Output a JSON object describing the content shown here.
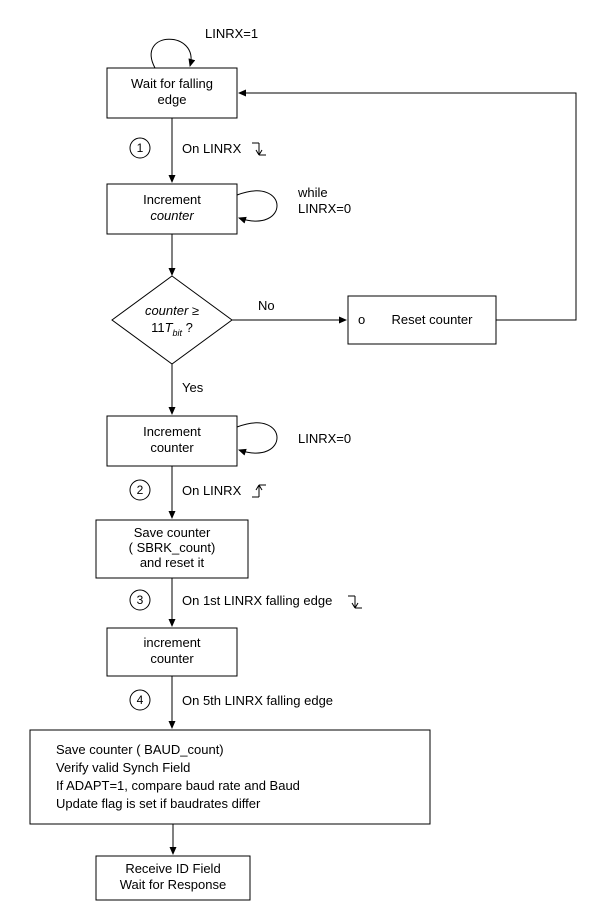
{
  "chart_data": {
    "type": "flowchart",
    "nodes": [
      {
        "id": "n1",
        "type": "process",
        "label": "Wait for falling edge",
        "self_loop_label": "LINRX=1"
      },
      {
        "id": "n2",
        "type": "process",
        "label": "Increment counter",
        "italic_on": "counter",
        "self_loop_label": "while LINRX=0"
      },
      {
        "id": "d1",
        "type": "decision",
        "label": "counter ≥ 11Tbit ?",
        "italic_on": "counter, Tbit"
      },
      {
        "id": "n3",
        "type": "process",
        "label": "Reset counter",
        "prefix": "o"
      },
      {
        "id": "n4",
        "type": "process",
        "label": "Increment counter",
        "self_loop_label": "LINRX=0"
      },
      {
        "id": "n5",
        "type": "process",
        "label": "Save counter ( SBRK_count) and reset it"
      },
      {
        "id": "n6",
        "type": "process",
        "label": "increment counter"
      },
      {
        "id": "n7",
        "type": "process",
        "label": "Save counter ( BAUD_count)\nVerify valid Synch Field\nIf ADAPT=1, compare baud rate and Baud\nUpdate flag is set if baudrates differ"
      },
      {
        "id": "n8",
        "type": "process",
        "label": "Receive ID Field\nWait for  Response"
      }
    ],
    "edges": [
      {
        "from": "n1",
        "to": "n2",
        "label": "On LINRX",
        "marker": "↓",
        "step": 1
      },
      {
        "from": "n2",
        "to": "d1"
      },
      {
        "from": "d1",
        "to": "n3",
        "label": "No"
      },
      {
        "from": "n3",
        "to": "n1"
      },
      {
        "from": "d1",
        "to": "n4",
        "label": "Yes"
      },
      {
        "from": "n4",
        "to": "n5",
        "label": "On LINRX",
        "marker": "↑",
        "step": 2
      },
      {
        "from": "n5",
        "to": "n6",
        "label": "On 1st LINRX falling edge",
        "marker": "↓",
        "step": 3
      },
      {
        "from": "n6",
        "to": "n7",
        "label": "On 5th LINRX falling edge",
        "step": 4
      },
      {
        "from": "n7",
        "to": "n8"
      }
    ]
  },
  "labels": {
    "self_loop_1": "LINRX=1",
    "n1_line1": "Wait for falling",
    "n1_line2": "edge",
    "step1_label": "On LINRX",
    "n2_line1": "Increment",
    "n2_line2": "counter",
    "self_loop_2a": "while",
    "self_loop_2b": "LINRX=0",
    "d1_line1a": "counter",
    "d1_line1b": " ≥",
    "d1_line2a": "11",
    "d1_line2b": "T",
    "d1_line2c": "bit",
    "d1_line2d": " ?",
    "no": "No",
    "yes": "Yes",
    "n3_prefix": "o",
    "n3_label": "Reset counter",
    "n4_line1": "Increment",
    "n4_line2": "counter",
    "self_loop_4": "LINRX=0",
    "step2_label": "On LINRX",
    "n5_line1": "Save counter",
    "n5_line2": "( SBRK_count)",
    "n5_line3": "and reset it",
    "step3_label": "On 1st LINRX falling edge",
    "n6_line1": "increment",
    "n6_line2": "counter",
    "step4_label": "On 5th LINRX falling edge",
    "n7_line1": "Save counter ( BAUD_count)",
    "n7_line2": "Verify valid Synch Field",
    "n7_line3": "If ADAPT=1, compare baud rate and Baud",
    "n7_line4": "Update flag is set if baudrates differ",
    "n8_line1": "Receive ID Field",
    "n8_line2": "Wait for  Response"
  },
  "steps": {
    "s1": "1",
    "s2": "2",
    "s3": "3",
    "s4": "4"
  }
}
